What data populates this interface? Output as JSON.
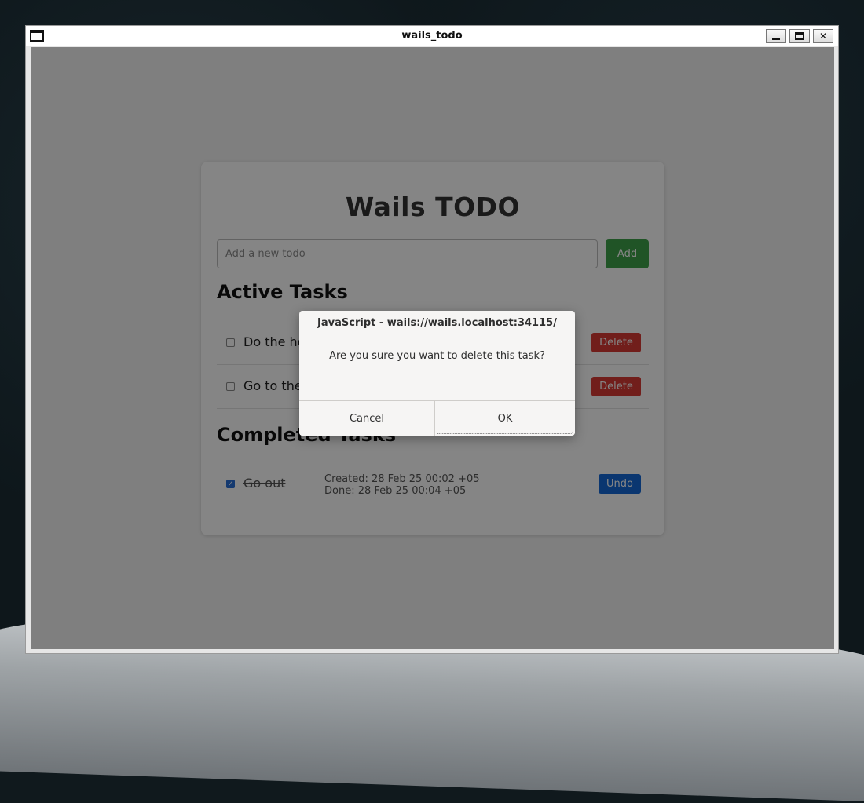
{
  "window": {
    "title": "wails_todo"
  },
  "app": {
    "title": "Wails TODO",
    "input_placeholder": "Add a new todo",
    "add_label": "Add",
    "active_section": "Active Tasks",
    "completed_section": "Completed Tasks",
    "active_tasks": [
      {
        "text": "Do the homework",
        "delete_label": "Delete"
      },
      {
        "text": "Go to the gym",
        "delete_label": "Delete"
      }
    ],
    "completed_tasks": [
      {
        "text": "Go out",
        "created": "Created: 28 Feb 25 00:02 +05",
        "done": "Done: 28 Feb 25 00:04 +05",
        "undo_label": "Undo"
      }
    ]
  },
  "dialog": {
    "title": "JavaScript - wails://wails.localhost:34115/",
    "message": "Are you sure you want to delete this task?",
    "cancel_label": "Cancel",
    "ok_label": "OK"
  },
  "colors": {
    "add_button": "#3fa24a",
    "delete_button": "#d93a34",
    "undo_button": "#1469d6",
    "checkbox_checked": "#2a6fd6"
  }
}
